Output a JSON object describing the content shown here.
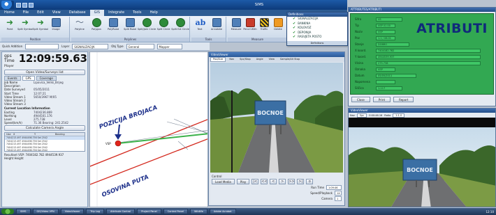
{
  "app": {
    "title": "SIMS",
    "menu": [
      "Home",
      "File",
      "Edit",
      "View",
      "Database",
      "GIS",
      "Integrate",
      "Tools",
      "Help"
    ],
    "active_menu": "GIS"
  },
  "ribbon": {
    "groups": [
      {
        "label": "Position",
        "tools": [
          "Point",
          "Split Symbol",
          "Split Symbol",
          "Image"
        ]
      },
      {
        "label": "Polylines",
        "tools": [
          "Polyline",
          "Polygon",
          "PolyRoad",
          "Split Road",
          "Split/Join Circle",
          "Split Circle",
          "Split Ext Circle"
        ]
      },
      {
        "label": "Tools",
        "tools": [
          "Text",
          "Annotate"
        ]
      },
      {
        "label": "Measure",
        "tools": [
          "Measure",
          "Pencil With",
          "Traffic",
          "Delete"
        ]
      }
    ]
  },
  "filterbar": {
    "search_label": "Quick Addition",
    "layer_label": "Layer",
    "layer_value": "SIGNALIZACIJA",
    "type_label": "Obj Type",
    "type_value": "General",
    "view_value": "Mapper"
  },
  "left_panel": {
    "gps_label": "gps Time",
    "gps_time": "12:09:59.63",
    "player_label": "Player",
    "open_button": "Open Video/Surveys list",
    "tabs": [
      "Events",
      "GPS",
      "Coverage"
    ],
    "job_info": [
      {
        "k": "Job Name",
        "v": "Lipovica_Veliki_Brijeg"
      },
      {
        "k": "Description",
        "v": ""
      },
      {
        "k": "Date Surveyed",
        "v": "05/05/2011"
      },
      {
        "k": "Start Time",
        "v": "12:07:21"
      },
      {
        "k": "Video Stream 1",
        "v": "5650/3967 M/05"
      },
      {
        "k": "Video Stream 2",
        "v": ""
      },
      {
        "k": "Video Stream 3",
        "v": ""
      }
    ],
    "location_title": "Current Location Information",
    "location": [
      {
        "k": "Easting",
        "v": "7404236.869"
      },
      {
        "k": "Northing",
        "v": "4944501.176"
      },
      {
        "k": "Level",
        "v": "275.738"
      },
      {
        "k": "Speed(km/h)",
        "v": "71.36   Bearing: 241.2542"
      }
    ],
    "calc_button": "Calculate Camera Angle",
    "table_headers": [
      "Use",
      "X",
      "Y",
      "Bearing"
    ],
    "table_rows": [
      "7404213.497  4944498.756  Set 2542",
      "7404213.497  4944498.756  Set 2542",
      "7404213.497  4944498.756  Set 2542",
      "7404213.497  4944498.756  Set 2542",
      "7404213.497  4944498.756  Set 2542"
    ],
    "resultant": "Resultant VSP: 7404182.782  4944539.937",
    "height": "Height  Height"
  },
  "map": {
    "label_counter": "POZICIJA BROJACA",
    "label_axis": "OSOVINA PUTA",
    "vsp_label": "VSP"
  },
  "video_window": {
    "title": "VideoViewer",
    "tabs": [
      "Pos/Size",
      "Nav",
      "Spc/Stop",
      "Angle",
      "View",
      "Sample/Alt Stop"
    ],
    "sign_text": "BOCNOE",
    "control_label": "Control",
    "load_button": "Load Media",
    "play_button": "Play",
    "nav_buttons": [
      "|<",
      "<<",
      "<",
      ">",
      ">>",
      ">|",
      "o"
    ],
    "run_time_label": "Run Time",
    "run_time_value": "1:09:46",
    "speed_label": "Speed/Playback",
    "speed_value": "1X",
    "camera_label": "Camera",
    "camera_value": "1"
  },
  "definitions": {
    "title": "Definitions",
    "items": [
      "SIGNALIZACIJA",
      "BANKINA",
      "KOLOVOZ",
      "DEPONIJA",
      "RASVJETA POSTO"
    ],
    "footer": "Definitions"
  },
  "attributes": {
    "title": "ATTRIBUTES/ATRIBUTI",
    "heading": "ATRIBUTI",
    "fields": [
      {
        "label": "Sifra",
        "value": "VS"
      },
      {
        "label": "Tip",
        "value": "VSP 01 00"
      },
      {
        "label": "Naziv",
        "value": "VSP"
      },
      {
        "label": "Poz",
        "value": "1.1 / 06.01"
      },
      {
        "label": "Stanje",
        "value": "DOBRO"
      },
      {
        "label": "X koord.",
        "value": "7404182.782"
      },
      {
        "label": "Y koord.",
        "value": "4944539.937"
      },
      {
        "label": "Visina",
        "value": "275.738"
      },
      {
        "label": "Oznaka",
        "value": "VSP"
      },
      {
        "label": "Datum",
        "value": "05/05/2011"
      },
      {
        "label": "Napomena",
        "value": ""
      },
      {
        "label": "Sličica",
        "value": "1-117"
      }
    ],
    "buttons": [
      "Close",
      "Print",
      "Report"
    ]
  },
  "video2": {
    "title": "VideoViewer",
    "toolbar": [
      "Nav",
      "Spc",
      "0:00:46.16",
      "Ratio",
      "1:1.0"
    ],
    "sign_text": "BOCNOE"
  },
  "taskbar": {
    "items": [
      "SIMS",
      "GIS/Video VPN",
      "VideoViewer",
      "Trip Log",
      "Attribute Control",
      "Project Panel",
      "Control Panel",
      "Wildlife",
      "Adobe Acrobat"
    ],
    "clock": "12:10"
  },
  "colors": {
    "attribute_green": "#32a852",
    "heading_blue": "#0f2a7a",
    "map_red": "#d42a1f",
    "map_green": "#3bb24a",
    "label_navy": "#1c2f8a"
  }
}
